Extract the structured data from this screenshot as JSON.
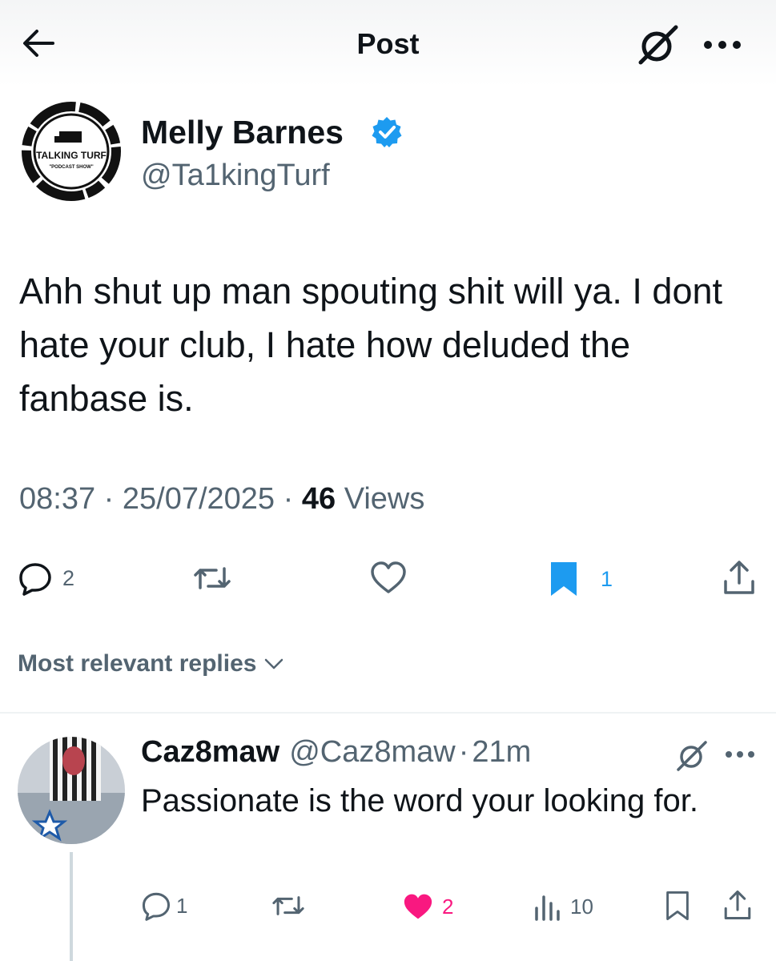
{
  "header": {
    "title": "Post"
  },
  "post": {
    "author": {
      "name": "Melly Barnes",
      "handle": "@Ta1kingTurf",
      "avatar_text": "TALKING TURF",
      "avatar_subtext": "\"PODCAST SHOW\""
    },
    "text": "Ahh shut up man spouting shit will ya. I dont hate your club, I hate how deluded the fanbase is.",
    "time": "08:37",
    "date": "25/07/2025",
    "separator": "·",
    "views_count": "46",
    "views_label": "Views",
    "actions": {
      "reply_count": "2",
      "bookmark_count": "1"
    }
  },
  "replies_section": {
    "sort_label": "Most relevant replies"
  },
  "reply": {
    "name": "Caz8maw",
    "handle": "@Caz8maw",
    "separator": "·",
    "time": "21m",
    "text": "Passionate is the word your looking for.",
    "actions": {
      "reply_count": "1",
      "like_count": "2",
      "views_count": "10"
    }
  },
  "colors": {
    "accent": "#1d9bf0",
    "text_primary": "#0f1419",
    "text_secondary": "#536471",
    "like": "#f91880",
    "divider": "#eff3f4"
  },
  "icons": {
    "back": "arrow-left-icon",
    "grok": "grok-icon",
    "more": "more-horizontal-icon",
    "verified": "verified-badge-icon",
    "reply": "reply-icon",
    "repost": "repost-icon",
    "like": "heart-icon",
    "bookmark": "bookmark-icon",
    "share": "share-icon",
    "views": "views-icon"
  }
}
